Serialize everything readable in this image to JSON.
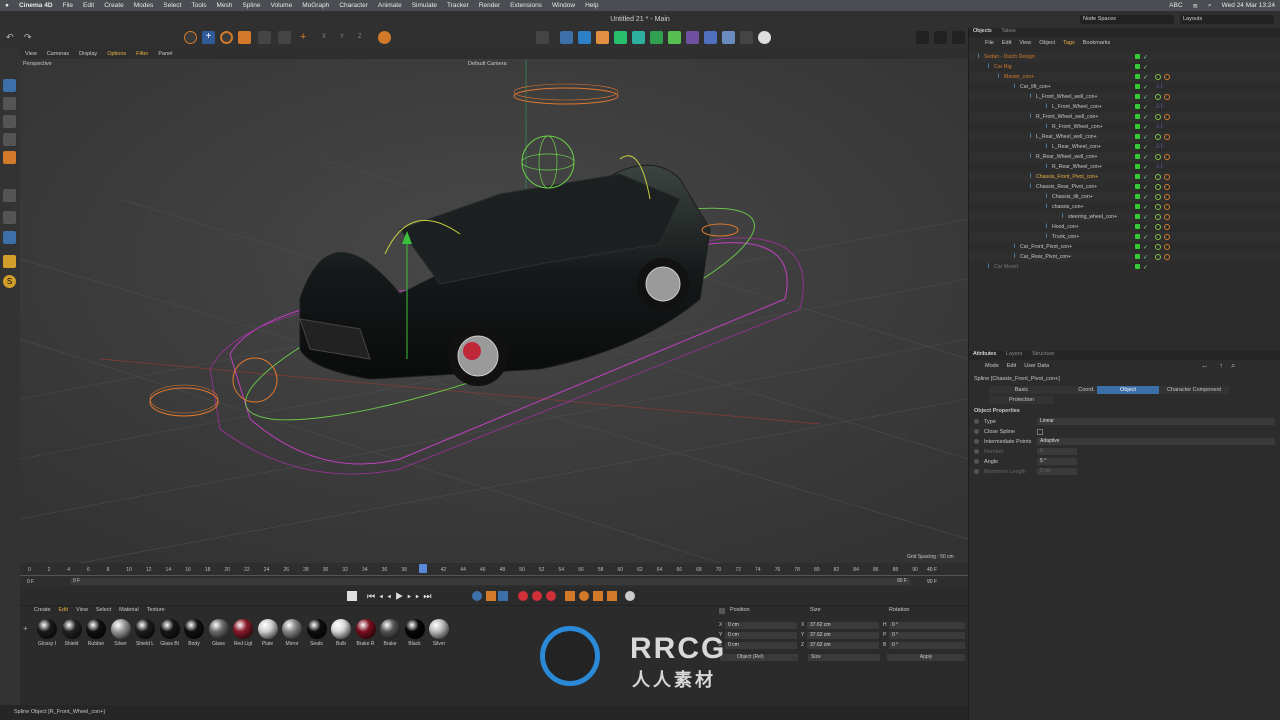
{
  "menubar": {
    "app": "Cinema 4D",
    "items": [
      "File",
      "Edit",
      "Create",
      "Modes",
      "Select",
      "Tools",
      "Mesh",
      "Spline",
      "Volume",
      "MoGraph",
      "Character",
      "Animate",
      "Simulate",
      "Tracker",
      "Render",
      "Extensions",
      "Window",
      "Help"
    ],
    "clock": "Wed 24 Mar 13:24",
    "abc": "ABC"
  },
  "window": {
    "title": "Untitled 21 * - Main",
    "node_spaces": "Node Spaces",
    "layouts": "Layouts"
  },
  "viewport": {
    "menu": [
      "View",
      "Cameras",
      "Display",
      "Options",
      "Filter",
      "Panel"
    ],
    "label": "Perspective",
    "camera": "Default Camera",
    "grid_spacing": "Grid Spacing : 50 cm"
  },
  "timeline": {
    "ticks": [
      "0",
      "2",
      "4",
      "6",
      "8",
      "10",
      "12",
      "14",
      "16",
      "18",
      "20",
      "22",
      "24",
      "26",
      "28",
      "30",
      "32",
      "34",
      "36",
      "38",
      "40",
      "42",
      "44",
      "46",
      "48",
      "50",
      "52",
      "54",
      "56",
      "58",
      "60",
      "62",
      "64",
      "66",
      "68",
      "70",
      "72",
      "74",
      "76",
      "78",
      "80",
      "82",
      "84",
      "86",
      "88",
      "90"
    ],
    "current_frame": "0 F",
    "start_frame": "0 F",
    "end_frame_a": "90 F",
    "end_frame_b": "90 F",
    "end_value_a": "40 F",
    "end_value_b": "90 F",
    "playhead_frame": 40
  },
  "materials": {
    "menu": [
      "Create",
      "Edit",
      "View",
      "Select",
      "Material",
      "Texture"
    ],
    "items": [
      {
        "name": "Glossy I",
        "color": "#1a1a1a"
      },
      {
        "name": "Shield",
        "color": "#222"
      },
      {
        "name": "Rubber",
        "color": "#111"
      },
      {
        "name": "Silver",
        "color": "#9a9a9a"
      },
      {
        "name": "Shield L",
        "color": "#1c1c1c"
      },
      {
        "name": "Glass Bl",
        "color": "#161616"
      },
      {
        "name": "Body",
        "color": "#101010"
      },
      {
        "name": "Glass",
        "color": "#6c6c6c"
      },
      {
        "name": "Red Ligl",
        "color": "#8a1a2a"
      },
      {
        "name": "Plate",
        "color": "#cfcfcf"
      },
      {
        "name": "Mirror",
        "color": "#888"
      },
      {
        "name": "Seats",
        "color": "#0d0d0d"
      },
      {
        "name": "Bulb",
        "color": "#d8d8d8"
      },
      {
        "name": "Brake R",
        "color": "#7a0f1e"
      },
      {
        "name": "Brake",
        "color": "#555"
      },
      {
        "name": "Black",
        "color": "#050505"
      },
      {
        "name": "Silver",
        "color": "#bdbdbd"
      }
    ]
  },
  "coords": {
    "headers": [
      "Position",
      "Size",
      "Rotation"
    ],
    "axes": [
      "X",
      "Y",
      "Z"
    ],
    "rot_axes": [
      "H",
      "P",
      "B"
    ],
    "pos": [
      "0 cm",
      "0 cm",
      "0 cm"
    ],
    "size": [
      "37.62 cm",
      "37.62 cm",
      "37.62 cm"
    ],
    "rot": [
      "0 °",
      "0 °",
      "0 °"
    ],
    "mode": "Object (Rel)",
    "size_mode": "Size",
    "apply": "Apply"
  },
  "status": "Spline Object [R_Front_Wheel_con+]",
  "objects_panel": {
    "tabs": [
      "Objects",
      "Takes"
    ],
    "menu": [
      "File",
      "Edit",
      "View",
      "Object",
      "Tags",
      "Bookmarks"
    ],
    "rows": [
      {
        "name": "Sedan - Dutch Design",
        "indent": 0,
        "color": "#d27a2a"
      },
      {
        "name": "Car Rig",
        "indent": 1,
        "color": "#d27a2a"
      },
      {
        "name": "Master_con+",
        "indent": 2,
        "color": "#d27a2a"
      },
      {
        "name": "Car_lift_con+",
        "indent": 3,
        "color": "#c8c8c8"
      },
      {
        "name": "L_Front_Wheel_well_con+",
        "indent": 4,
        "color": "#c8c8c8"
      },
      {
        "name": "L_Front_Wheel_con+",
        "indent": 5,
        "color": "#c8c8c8"
      },
      {
        "name": "R_Front_Wheel_well_con+",
        "indent": 4,
        "color": "#c8c8c8"
      },
      {
        "name": "R_Front_Wheel_con+",
        "indent": 5,
        "color": "#c8c8c8"
      },
      {
        "name": "L_Rear_Wheel_well_con+",
        "indent": 4,
        "color": "#c8c8c8"
      },
      {
        "name": "L_Rear_Wheel_con+",
        "indent": 5,
        "color": "#c8c8c8"
      },
      {
        "name": "R_Rear_Wheel_well_con+",
        "indent": 4,
        "color": "#c8c8c8"
      },
      {
        "name": "R_Rear_Wheel_con+",
        "indent": 5,
        "color": "#c8c8c8"
      },
      {
        "name": "Chassis_Front_Pivot_con+",
        "indent": 4,
        "color": "#e8b040"
      },
      {
        "name": "Chassis_Rear_Pivot_con+",
        "indent": 4,
        "color": "#c8c8c8"
      },
      {
        "name": "Chassis_tilt_con+",
        "indent": 5,
        "color": "#c8c8c8"
      },
      {
        "name": "chassis_con+",
        "indent": 5,
        "color": "#c8c8c8"
      },
      {
        "name": "steering_wheel_con+",
        "indent": 6,
        "color": "#c8c8c8"
      },
      {
        "name": "Hood_con+",
        "indent": 5,
        "color": "#c8c8c8"
      },
      {
        "name": "Trunk_con+",
        "indent": 5,
        "color": "#c8c8c8"
      },
      {
        "name": "Car_Front_Pivot_con+",
        "indent": 3,
        "color": "#c8c8c8"
      },
      {
        "name": "Car_Rear_Pivot_con+",
        "indent": 3,
        "color": "#c8c8c8"
      },
      {
        "name": "Car Model",
        "indent": 1,
        "color": "#777"
      }
    ]
  },
  "attributes": {
    "tabs": [
      "Attributes",
      "Layers",
      "Structure"
    ],
    "menu": [
      "Mode",
      "Edit",
      "User Data"
    ],
    "object_title": "Spline [Chassis_Front_Pivot_con+]",
    "subtabs": [
      "Basic",
      "Coord.",
      "Object",
      "Character Component",
      "Protection"
    ],
    "active_subtab": "Object",
    "section": "Object Properties",
    "props": [
      {
        "label": "Type",
        "value": "Linear"
      },
      {
        "label": "Close Spline",
        "value": ""
      },
      {
        "label": "Intermediate Points",
        "value": "Adaptive"
      },
      {
        "label": "Number",
        "value": "8"
      },
      {
        "label": "Angle",
        "value": "5 °"
      },
      {
        "label": "Maximum Length",
        "value": "5 cm"
      }
    ]
  },
  "watermark": {
    "brand": "RRCG",
    "subtitle": "人人素材"
  }
}
